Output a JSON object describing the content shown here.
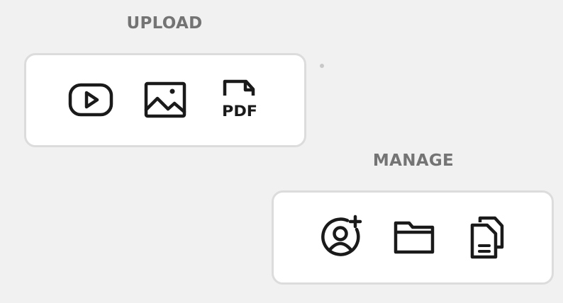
{
  "upload": {
    "title": "UPLOAD",
    "buttons": [
      {
        "icon": "video-play-icon"
      },
      {
        "icon": "image-icon"
      },
      {
        "icon": "pdf-file-icon",
        "icon_text": "PDF"
      }
    ]
  },
  "manage": {
    "title": "MANAGE",
    "buttons": [
      {
        "icon": "add-user-icon"
      },
      {
        "icon": "folder-icon"
      },
      {
        "icon": "documents-icon"
      }
    ]
  },
  "colors": {
    "background": "#f1f1f1",
    "panel": "#ffffff",
    "panel_border": "#dcdcdc",
    "title": "#747474",
    "icon_stroke": "#1a1a1a"
  }
}
